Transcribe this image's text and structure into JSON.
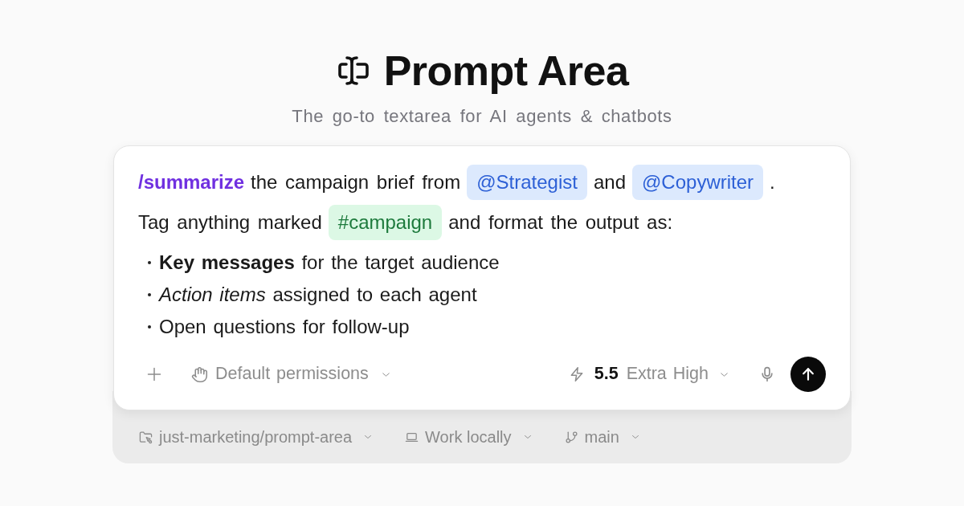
{
  "header": {
    "title": "Prompt Area",
    "subtitle": "The go-to textarea for AI agents & chatbots"
  },
  "prompt": {
    "lines": [
      {
        "segments": [
          {
            "kind": "command",
            "text": "/summarize"
          },
          {
            "kind": "text",
            "text": "the campaign brief from"
          },
          {
            "kind": "mention",
            "text": "@Strategist"
          },
          {
            "kind": "text",
            "text": "and"
          },
          {
            "kind": "mention",
            "text": "@Copywriter"
          },
          {
            "kind": "text",
            "text": "."
          }
        ]
      },
      {
        "segments": [
          {
            "kind": "text",
            "text": "Tag anything marked"
          },
          {
            "kind": "tag",
            "text": "#campaign"
          },
          {
            "kind": "text",
            "text": "and format the output as:"
          }
        ]
      }
    ],
    "bullets": [
      "**Key messages** for the target audience",
      "*Action items* assigned to each agent",
      "Open questions for follow-up"
    ]
  },
  "toolbar": {
    "permissions": "Default permissions",
    "model": {
      "version": "5.5",
      "effort": "Extra High"
    }
  },
  "footer": [
    {
      "kind": "folder",
      "label": "just-marketing/prompt-area"
    },
    {
      "kind": "laptop",
      "label": "Work locally"
    },
    {
      "kind": "branch",
      "label": "main"
    }
  ]
}
